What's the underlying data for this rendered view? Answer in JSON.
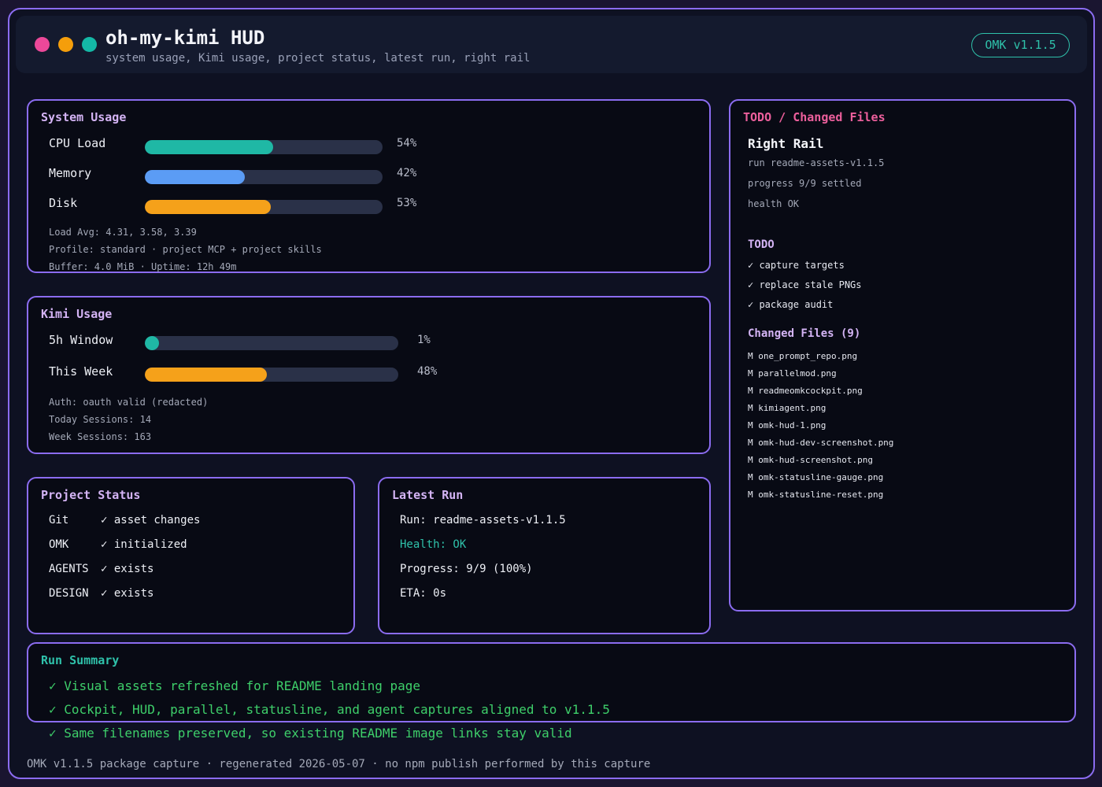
{
  "header": {
    "title": "oh-my-kimi HUD",
    "subtitle": "system usage, Kimi usage, project status, latest run, right rail",
    "version": "OMK v1.1.5",
    "dot_colors": [
      "#ec4899",
      "#f59e0b",
      "#14b8a6"
    ]
  },
  "system_usage": {
    "title": "System Usage",
    "bars": [
      {
        "label": "CPU Load",
        "value": 54,
        "display": "54%",
        "color": "#1fb8a5"
      },
      {
        "label": "Memory",
        "value": 42,
        "display": "42%",
        "color": "#5b9cf5"
      },
      {
        "label": "Disk",
        "value": 53,
        "display": "53%",
        "color": "#f5a11a"
      }
    ],
    "meta": [
      "Load Avg: 4.31, 3.58, 3.39",
      "Profile: standard · project MCP + project skills",
      "Buffer: 4.0 MiB · Uptime: 12h 49m"
    ]
  },
  "kimi_usage": {
    "title": "Kimi Usage",
    "bars": [
      {
        "label": "5h Window",
        "value": 1,
        "display": "1%",
        "color": "#1fb8a5"
      },
      {
        "label": "This Week",
        "value": 48,
        "display": "48%",
        "color": "#f5a11a"
      }
    ],
    "meta": [
      "Auth: oauth valid (redacted)",
      "Today Sessions: 14",
      "Week Sessions: 163"
    ]
  },
  "project_status": {
    "title": "Project Status",
    "rows": [
      {
        "key": "Git",
        "value": "✓ asset changes"
      },
      {
        "key": "OMK",
        "value": "✓ initialized"
      },
      {
        "key": "AGENTS",
        "value": "✓ exists"
      },
      {
        "key": "DESIGN",
        "value": "✓ exists"
      }
    ]
  },
  "latest_run": {
    "title": "Latest Run",
    "run": "Run: readme-assets-v1.1.5",
    "health": "Health: OK",
    "progress": "Progress: 9/9 (100%)",
    "eta": "ETA: 0s",
    "health_color": "#2fc1aa"
  },
  "right_rail": {
    "title": "TODO / Changed Files",
    "title_color": "#ec5f9c",
    "heading": "Right Rail",
    "meta": [
      "run readme-assets-v1.1.5",
      "progress 9/9 settled",
      "health OK"
    ],
    "todo_title": "TODO",
    "todos": [
      "✓ capture targets",
      "✓ replace stale PNGs",
      "✓ package audit"
    ],
    "changed_title": "Changed Files (9)",
    "files": [
      "M one_prompt_repo.png",
      "M parallelmod.png",
      "M readmeomkcockpit.png",
      "M kimiagent.png",
      "M omk-hud-1.png",
      "M omk-hud-dev-screenshot.png",
      "M omk-hud-screenshot.png",
      "M omk-statusline-gauge.png",
      "M omk-statusline-reset.png"
    ]
  },
  "run_summary": {
    "title": "Run Summary",
    "title_color": "#2fc1aa",
    "lines": [
      "✓ Visual assets refreshed for README landing page",
      "✓ Cockpit, HUD, parallel, statusline, and agent captures aligned to v1.1.5",
      "✓ Same filenames preserved, so existing README image links stay valid"
    ]
  },
  "footer": "OMK v1.1.5 package capture · regenerated 2026-05-07 · no npm publish performed by this capture"
}
